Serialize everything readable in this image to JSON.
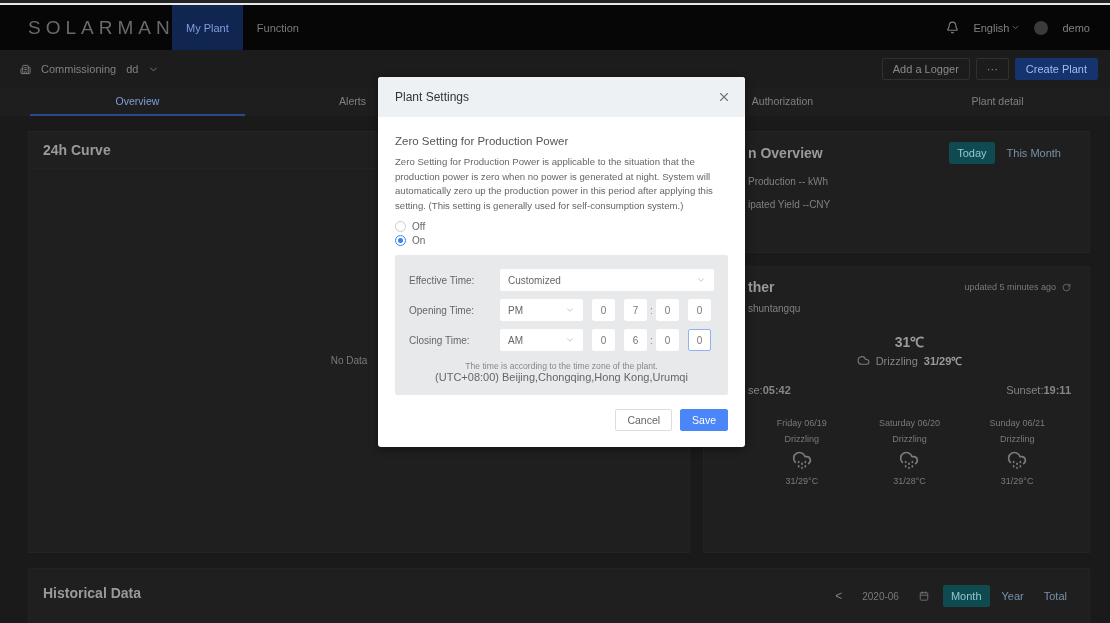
{
  "top_bar": {
    "logo": "SOLARMAN",
    "nav": [
      {
        "label": "My Plant",
        "selected": true
      },
      {
        "label": "Function",
        "selected": false
      }
    ],
    "language": "English",
    "user": "demo"
  },
  "sub_header": {
    "status": "Commissioning",
    "plant": "dd",
    "buttons": [
      {
        "label": "Add a Logger",
        "kind": "outline"
      },
      {
        "label": "···",
        "kind": "outline"
      },
      {
        "label": "Create Plant",
        "kind": "primary"
      }
    ]
  },
  "tabs": [
    {
      "label": "Overview",
      "selected": true
    },
    {
      "label": "Alerts",
      "selected": false
    },
    {
      "label": "Authorization",
      "selected": false
    },
    {
      "label": "Plant detail",
      "selected": false
    }
  ],
  "curve_card": {
    "title": "24h Curve",
    "empty_text": "No Data"
  },
  "overview_card": {
    "title": "n Overview",
    "periods": [
      {
        "label": "Today",
        "selected": true
      },
      {
        "label": "This Month",
        "selected": false
      }
    ],
    "rows": [
      "Production -- kWh",
      "ipated Yield --CNY"
    ]
  },
  "weather_card": {
    "title": "ther",
    "updated": "updated 5 minutes ago",
    "location": "shuntangqu",
    "temperature": "31℃",
    "condition": "Drizzling",
    "range": "31/29℃",
    "sunrise_label": "se:",
    "sunrise": "05:42",
    "sunset_label": "Sunset:",
    "sunset": "19:11",
    "forecast": [
      {
        "day": "Friday 06/19",
        "condition": "Drizzling",
        "range": "31/29°C"
      },
      {
        "day": "Saturday 06/20",
        "condition": "Drizzling",
        "range": "31/28°C"
      },
      {
        "day": "Sunday 06/21",
        "condition": "Drizzling",
        "range": "31/29°C"
      }
    ]
  },
  "history_card": {
    "title": "Historical Data",
    "prev": "<",
    "date": "2020-06",
    "periods": [
      {
        "label": "Month",
        "selected": true
      },
      {
        "label": "Year",
        "selected": false
      },
      {
        "label": "Total",
        "selected": false
      }
    ]
  },
  "dialog": {
    "title": "Plant Settings",
    "heading": "Zero Setting for Production Power",
    "description": "Zero Setting for Production Power is applicable to the situation that the production power is zero when no power is generated at night. System will automatically zero up the production power in this period after applying this setting. (This setting is generally used for self-consumption system.)",
    "options": [
      {
        "label": "Off",
        "selected": false
      },
      {
        "label": "On",
        "selected": true
      }
    ],
    "rows": [
      {
        "kind": "select",
        "label": "Effective Time:",
        "value": "Customized"
      },
      {
        "kind": "time",
        "label": "Opening Time:",
        "period": "PM",
        "separator": ":",
        "digits": [
          {
            "value": "0",
            "focused": false
          },
          {
            "value": "7",
            "focused": false
          },
          {
            "value": "0",
            "focused": false
          },
          {
            "value": "0",
            "focused": false
          }
        ]
      },
      {
        "kind": "time",
        "label": "Closing Time:",
        "period": "AM",
        "separator": ":",
        "digits": [
          {
            "value": "0",
            "focused": false
          },
          {
            "value": "6",
            "focused": false
          },
          {
            "value": "0",
            "focused": false
          },
          {
            "value": "0",
            "focused": true
          }
        ]
      }
    ],
    "note": "The time is according to the time zone of the plant.",
    "timezone": "(UTC+08:00) Beijing,Chongqing,Hong Kong,Urumqi",
    "buttons": [
      {
        "label": "Cancel",
        "kind": "secondary"
      },
      {
        "label": "Save",
        "kind": "primary"
      }
    ]
  }
}
